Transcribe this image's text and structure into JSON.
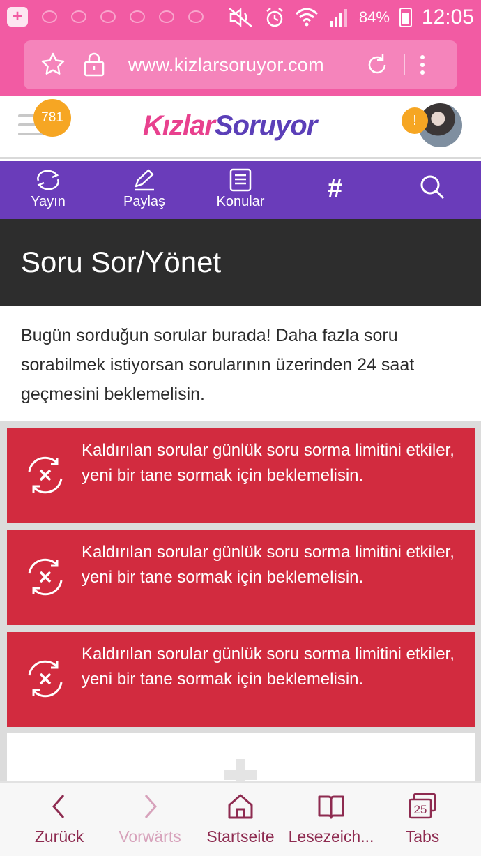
{
  "status_bar": {
    "battery": "84%",
    "time": "12:05"
  },
  "browser": {
    "url": "www.kizlarsoruyor.com"
  },
  "site_header": {
    "notification_count": "781",
    "logo_part1": "Kızlar",
    "logo_part2": "Soruyor",
    "alert_badge": "!"
  },
  "nav": {
    "items": [
      {
        "label": "Yayın",
        "icon": "refresh-icon"
      },
      {
        "label": "Paylaş",
        "icon": "pencil-icon"
      },
      {
        "label": "Konular",
        "icon": "list-icon"
      }
    ],
    "hash": "#"
  },
  "page": {
    "title": "Soru Sor/Yönet",
    "intro": "Bugün sorduğun sorular burada! Daha fazla soru sorabilmek istiyorsan sorularının üzerinden 24 saat geçmesini beklemelisin."
  },
  "alerts": [
    {
      "message": "Kaldırılan sorular günlük soru sorma limitini etkiler, yeni bir tane sormak için beklemelisin."
    },
    {
      "message": "Kaldırılan sorular günlük soru sorma limitini etkiler, yeni bir tane sormak için beklemelisin."
    },
    {
      "message": "Kaldırılan sorular günlük soru sorma limitini etkiler, yeni bir tane sormak için beklemelisin."
    }
  ],
  "bottom_bar": {
    "back": "Zurück",
    "forward": "Vorwärts",
    "home": "Startseite",
    "bookmarks": "Lesezeich...",
    "tabs": "Tabs",
    "tab_count": "25"
  },
  "colors": {
    "browser_pink": "#f25ba3",
    "nav_purple": "#6a3cba",
    "alert_red": "#d22b3f",
    "title_dark": "#2d2d2d"
  }
}
